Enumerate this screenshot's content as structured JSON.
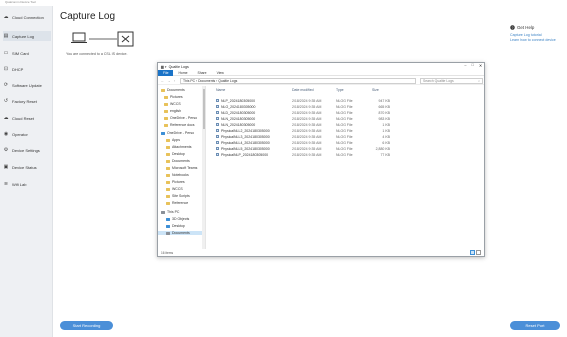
{
  "app": {
    "title": "Qualcomm Device Tool"
  },
  "sidebar": {
    "items": [
      {
        "label": "Cloud Connection",
        "icon": "cloud-icon"
      },
      {
        "label": "Capture Log",
        "icon": "document-icon"
      },
      {
        "label": "SIM Card",
        "icon": "sim-card-icon"
      },
      {
        "label": "DHCP",
        "icon": "network-icon"
      },
      {
        "label": "Software Update",
        "icon": "update-icon"
      },
      {
        "label": "Factory Reset",
        "icon": "reset-icon"
      },
      {
        "label": "Cloud Reset",
        "icon": "cloud-reset-icon"
      },
      {
        "label": "Operator",
        "icon": "operator-icon"
      },
      {
        "label": "Device Settings",
        "icon": "settings-icon"
      },
      {
        "label": "Device Status",
        "icon": "status-icon"
      },
      {
        "label": "Wifi Lab",
        "icon": "wifi-icon"
      }
    ]
  },
  "main": {
    "title": "Capture Log",
    "device_caption": "You are connected to a CSL IS device."
  },
  "help": {
    "title": "Get Help",
    "links": [
      "Capture Log tutorial",
      "Learn how to connect device"
    ]
  },
  "buttons": {
    "start": "Start Recording",
    "reset": "Reset Port"
  },
  "explorer": {
    "title": "Qualtie Logs",
    "ribbon": [
      "File",
      "Home",
      "Share",
      "View"
    ],
    "address": "This PC  ›  Documents  ›  Qualtie Logs",
    "search_placeholder": "Search Qualtie Logs",
    "nav_tree": [
      {
        "label": "Documents",
        "type": "folder"
      },
      {
        "label": "Pictures",
        "type": "folder"
      },
      {
        "label": "WCCS",
        "type": "folder"
      },
      {
        "label": "english",
        "type": "folder"
      },
      {
        "label": "OneDrive - Perso",
        "type": "folder"
      },
      {
        "label": "Reference docs",
        "type": "folder"
      },
      {
        "label": "OneDrive - Perso",
        "type": "cloud"
      },
      {
        "label": "Apps",
        "type": "folder"
      },
      {
        "label": "Attachments",
        "type": "folder"
      },
      {
        "label": "Desktop",
        "type": "folder"
      },
      {
        "label": "Documents",
        "type": "folder"
      },
      {
        "label": "Microsoft Teams",
        "type": "folder"
      },
      {
        "label": "Notebooks",
        "type": "folder"
      },
      {
        "label": "Pictures",
        "type": "folder"
      },
      {
        "label": "WCCS",
        "type": "folder"
      },
      {
        "label": "Site Scripts",
        "type": "folder"
      },
      {
        "label": "Reference",
        "type": "folder"
      },
      {
        "label": "This PC",
        "type": "pc"
      },
      {
        "label": "3D Objects",
        "type": "folder"
      },
      {
        "label": "Desktop",
        "type": "folder"
      },
      {
        "label": "Documents",
        "type": "folder"
      }
    ],
    "columns": {
      "name": "Name",
      "date": "Date modified",
      "type": "Type",
      "size": "Size"
    },
    "files": [
      {
        "name": "NLP_2024180305000",
        "date": "2/18/2024 9:35 AM",
        "type": "NLOG File",
        "size": "947 KB"
      },
      {
        "name": "NLO_2024180305000",
        "date": "2/18/2024 9:35 AM",
        "type": "NLOG File",
        "size": "665 KB"
      },
      {
        "name": "NLD_2024180305000",
        "date": "2/18/2024 9:35 AM",
        "type": "NLOG File",
        "size": "870 KB"
      },
      {
        "name": "NLN_2024180305000",
        "date": "2/18/2024 9:35 AM",
        "type": "NLOG File",
        "size": "983 KB"
      },
      {
        "name": "NLN_2024180305000",
        "date": "2/18/2024 9:35 AM",
        "type": "NLOG File",
        "size": "1 KB"
      },
      {
        "name": "PhysicalNLL2_2024180305000",
        "date": "2/18/2024 9:35 AM",
        "type": "NLOG File",
        "size": "1 KB"
      },
      {
        "name": "PhysicalNLL3_2024180305000",
        "date": "2/18/2024 9:35 AM",
        "type": "NLOG File",
        "size": "4 KB"
      },
      {
        "name": "PhysicalNLL4_2024180305000",
        "date": "2/18/2024 9:35 AM",
        "type": "NLOG File",
        "size": "6 KB"
      },
      {
        "name": "PhysicalNLL5_2024180305000",
        "date": "2/18/2024 9:35 AM",
        "type": "NLOG File",
        "size": "2,880 KB"
      },
      {
        "name": "PhysicalNLP_2024180305000",
        "date": "2/18/2024 9:35 AM",
        "type": "NLOG File",
        "size": "77 KB"
      }
    ],
    "status": "16 items"
  },
  "colors": {
    "accent": "#4b8fd8",
    "sidebar_bg": "#eef0f3",
    "link": "#3b82c4",
    "file_tab": "#1a73c7"
  }
}
